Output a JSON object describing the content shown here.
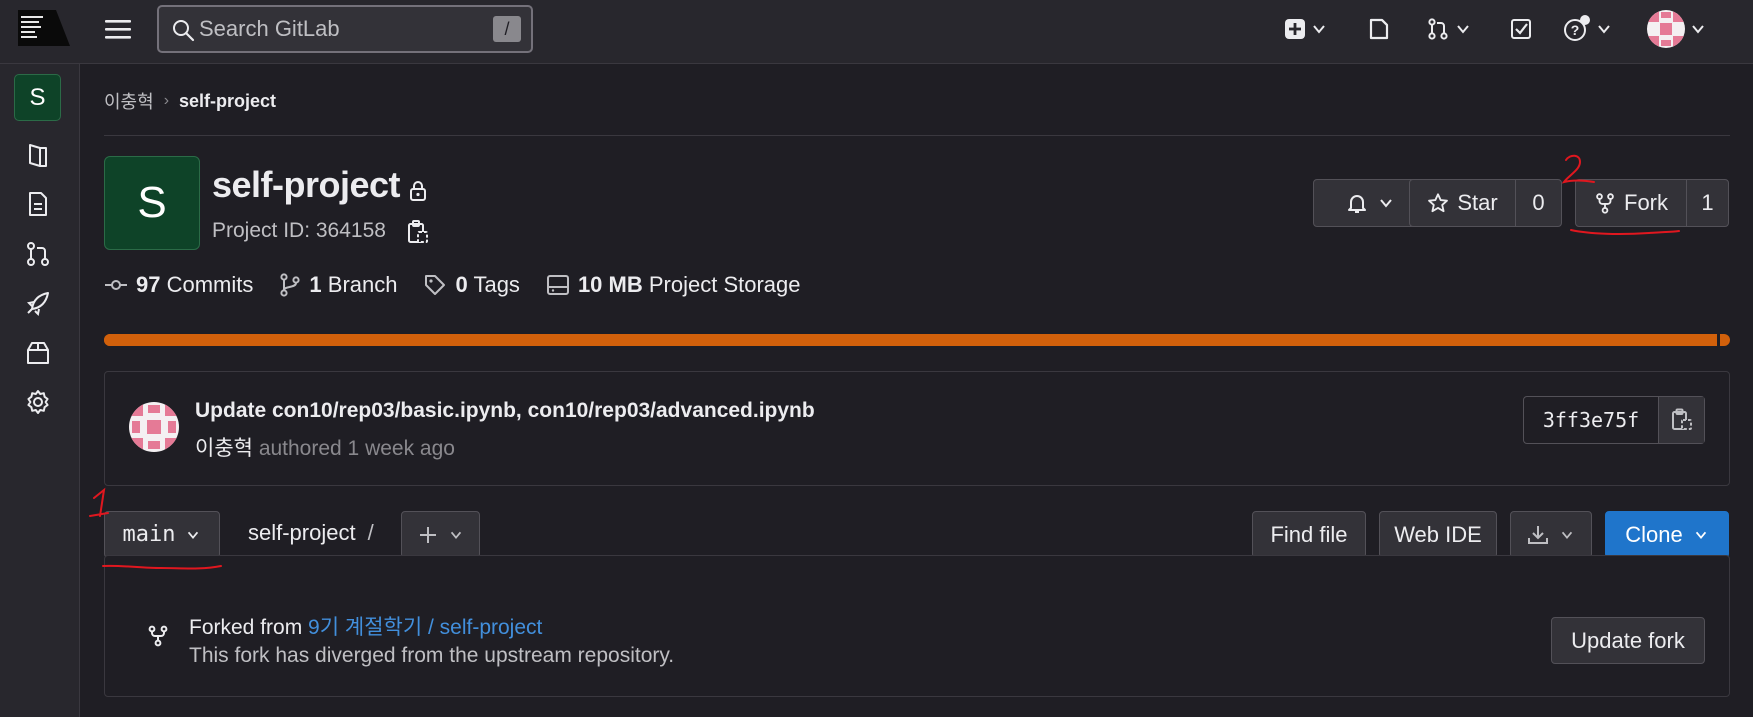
{
  "search": {
    "placeholder": "Search GitLab",
    "shortcut": "/"
  },
  "topbar": {
    "icons": [
      "plus-square-icon",
      "issues-icon",
      "merge-request-icon",
      "todo-icon",
      "help-icon",
      "user-avatar"
    ]
  },
  "sidebar": {
    "project_letter": "S",
    "items": [
      {
        "name": "project-overview",
        "icon": "book-icon"
      },
      {
        "name": "repository",
        "icon": "document-icon"
      },
      {
        "name": "merge-requests",
        "icon": "merge-request-icon"
      },
      {
        "name": "deployments",
        "icon": "rocket-icon"
      },
      {
        "name": "packages",
        "icon": "package-icon"
      },
      {
        "name": "settings",
        "icon": "gear-icon"
      }
    ]
  },
  "breadcrumb": {
    "parent": "이충혁",
    "separator": "›",
    "current": "self-project"
  },
  "project": {
    "avatar_letter": "S",
    "name": "self-project",
    "id_text": "Project ID: 364158"
  },
  "actions": {
    "star_label": "Star",
    "star_count": "0",
    "fork_label": "Fork",
    "fork_count": "1"
  },
  "stats": {
    "commits_count": "97",
    "commits_label": "Commits",
    "branches_count": "1",
    "branches_label": "Branch",
    "tags_count": "0",
    "tags_label": "Tags",
    "storage_value": "10 MB",
    "storage_label": "Project Storage"
  },
  "storage_bar": {
    "fill_fraction": 0.99,
    "color": "#d1600b"
  },
  "last_commit": {
    "title": "Update con10/rep03/basic.ipynb, con10/rep03/advanced.ipynb",
    "author": "이충혁",
    "meta": "authored 1 week ago",
    "sha": "3ff3e75f"
  },
  "repo_toolbar": {
    "branch": "main",
    "path_root": "self-project",
    "path_sep": "/",
    "find_file": "Find file",
    "web_ide": "Web IDE",
    "clone": "Clone"
  },
  "fork_info": {
    "prefix": "Forked from",
    "source": "9기 계절학기 / self-project",
    "status": "This fork has diverged from the upstream repository.",
    "update_button": "Update fork"
  },
  "annotations": {
    "one": "1",
    "two": "2"
  },
  "colors": {
    "brand_blue": "#1f75cb",
    "link_blue": "#428fdc",
    "avatar_green": "#0e4328",
    "progress_orange": "#d1600b",
    "annotation_red": "#e0171f"
  }
}
